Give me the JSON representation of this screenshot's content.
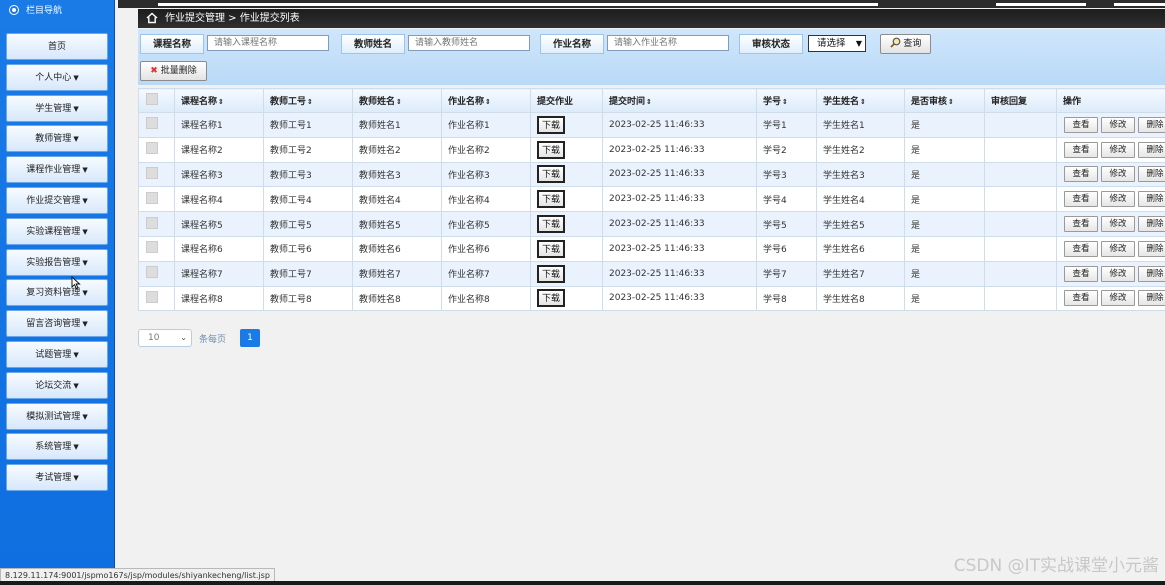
{
  "sidebar": {
    "title": "栏目导航",
    "items": [
      {
        "label": "首页",
        "dropdown": false
      },
      {
        "label": "个人中心",
        "dropdown": true
      },
      {
        "label": "学生管理",
        "dropdown": true
      },
      {
        "label": "教师管理",
        "dropdown": true
      },
      {
        "label": "课程作业管理",
        "dropdown": true
      },
      {
        "label": "作业提交管理",
        "dropdown": true
      },
      {
        "label": "实验课程管理",
        "dropdown": true
      },
      {
        "label": "实验报告管理",
        "dropdown": true
      },
      {
        "label": "复习资料管理",
        "dropdown": true
      },
      {
        "label": "留言咨询管理",
        "dropdown": true
      },
      {
        "label": "试题管理",
        "dropdown": true
      },
      {
        "label": "论坛交流",
        "dropdown": true
      },
      {
        "label": "模拟测试管理",
        "dropdown": true
      },
      {
        "label": "系统管理",
        "dropdown": true
      },
      {
        "label": "考试管理",
        "dropdown": true
      }
    ]
  },
  "breadcrumb": {
    "text": "作业提交管理 > 作业提交列表"
  },
  "search": {
    "course_label": "课程名称",
    "course_placeholder": "请输入课程名称",
    "teacher_label": "教师姓名",
    "teacher_placeholder": "请输入教师姓名",
    "homework_label": "作业名称",
    "homework_placeholder": "请输入作业名称",
    "review_label": "审核状态",
    "review_select": "请选择",
    "query_button": "查询",
    "batch_delete_button": "批量删除"
  },
  "table": {
    "headers": [
      "课程名称",
      "教师工号",
      "教师姓名",
      "作业名称",
      "提交作业",
      "提交时间",
      "学号",
      "学生姓名",
      "是否审核",
      "审核回复",
      "操作"
    ],
    "download_label": "下载",
    "actions": [
      "查看",
      "修改",
      "删除"
    ],
    "rows": [
      {
        "course": "课程名称1",
        "teacher_no": "教师工号1",
        "teacher_name": "教师姓名1",
        "homework": "作业名称1",
        "time": "2023-02-25 11:46:33",
        "student_no": "学号1",
        "student_name": "学生姓名1",
        "reviewed": "是",
        "reply": ""
      },
      {
        "course": "课程名称2",
        "teacher_no": "教师工号2",
        "teacher_name": "教师姓名2",
        "homework": "作业名称2",
        "time": "2023-02-25 11:46:33",
        "student_no": "学号2",
        "student_name": "学生姓名2",
        "reviewed": "是",
        "reply": ""
      },
      {
        "course": "课程名称3",
        "teacher_no": "教师工号3",
        "teacher_name": "教师姓名3",
        "homework": "作业名称3",
        "time": "2023-02-25 11:46:33",
        "student_no": "学号3",
        "student_name": "学生姓名3",
        "reviewed": "是",
        "reply": ""
      },
      {
        "course": "课程名称4",
        "teacher_no": "教师工号4",
        "teacher_name": "教师姓名4",
        "homework": "作业名称4",
        "time": "2023-02-25 11:46:33",
        "student_no": "学号4",
        "student_name": "学生姓名4",
        "reviewed": "是",
        "reply": ""
      },
      {
        "course": "课程名称5",
        "teacher_no": "教师工号5",
        "teacher_name": "教师姓名5",
        "homework": "作业名称5",
        "time": "2023-02-25 11:46:33",
        "student_no": "学号5",
        "student_name": "学生姓名5",
        "reviewed": "是",
        "reply": ""
      },
      {
        "course": "课程名称6",
        "teacher_no": "教师工号6",
        "teacher_name": "教师姓名6",
        "homework": "作业名称6",
        "time": "2023-02-25 11:46:33",
        "student_no": "学号6",
        "student_name": "学生姓名6",
        "reviewed": "是",
        "reply": ""
      },
      {
        "course": "课程名称7",
        "teacher_no": "教师工号7",
        "teacher_name": "教师姓名7",
        "homework": "作业名称7",
        "time": "2023-02-25 11:46:33",
        "student_no": "学号7",
        "student_name": "学生姓名7",
        "reviewed": "是",
        "reply": ""
      },
      {
        "course": "课程名称8",
        "teacher_no": "教师工号8",
        "teacher_name": "教师姓名8",
        "homework": "作业名称8",
        "time": "2023-02-25 11:46:33",
        "student_no": "学号8",
        "student_name": "学生姓名8",
        "reviewed": "是",
        "reply": ""
      }
    ]
  },
  "pager": {
    "page_size": "10",
    "per_page_label": "条每页",
    "current_page": "1"
  },
  "status_url": "8.129.11.174:9001/jspmo167s/jsp/modules/shiyankecheng/list.jsp",
  "watermark": "CSDN @IT实战课堂小元酱",
  "icons": {
    "sidebar_title": "circle-dot-icon",
    "home": "home-icon",
    "query": "magnifier-icon",
    "batch_delete": "red-x-icon",
    "sort": "sort-arrows-icon",
    "caret": "caret-down-icon"
  },
  "colors": {
    "sidebar_bg": "#1a7ae6",
    "search_bg": "#b9d9f7",
    "row_alt": "#eaf3fd",
    "pager_active": "#1a7ae6",
    "delete_icon": "#d33"
  }
}
